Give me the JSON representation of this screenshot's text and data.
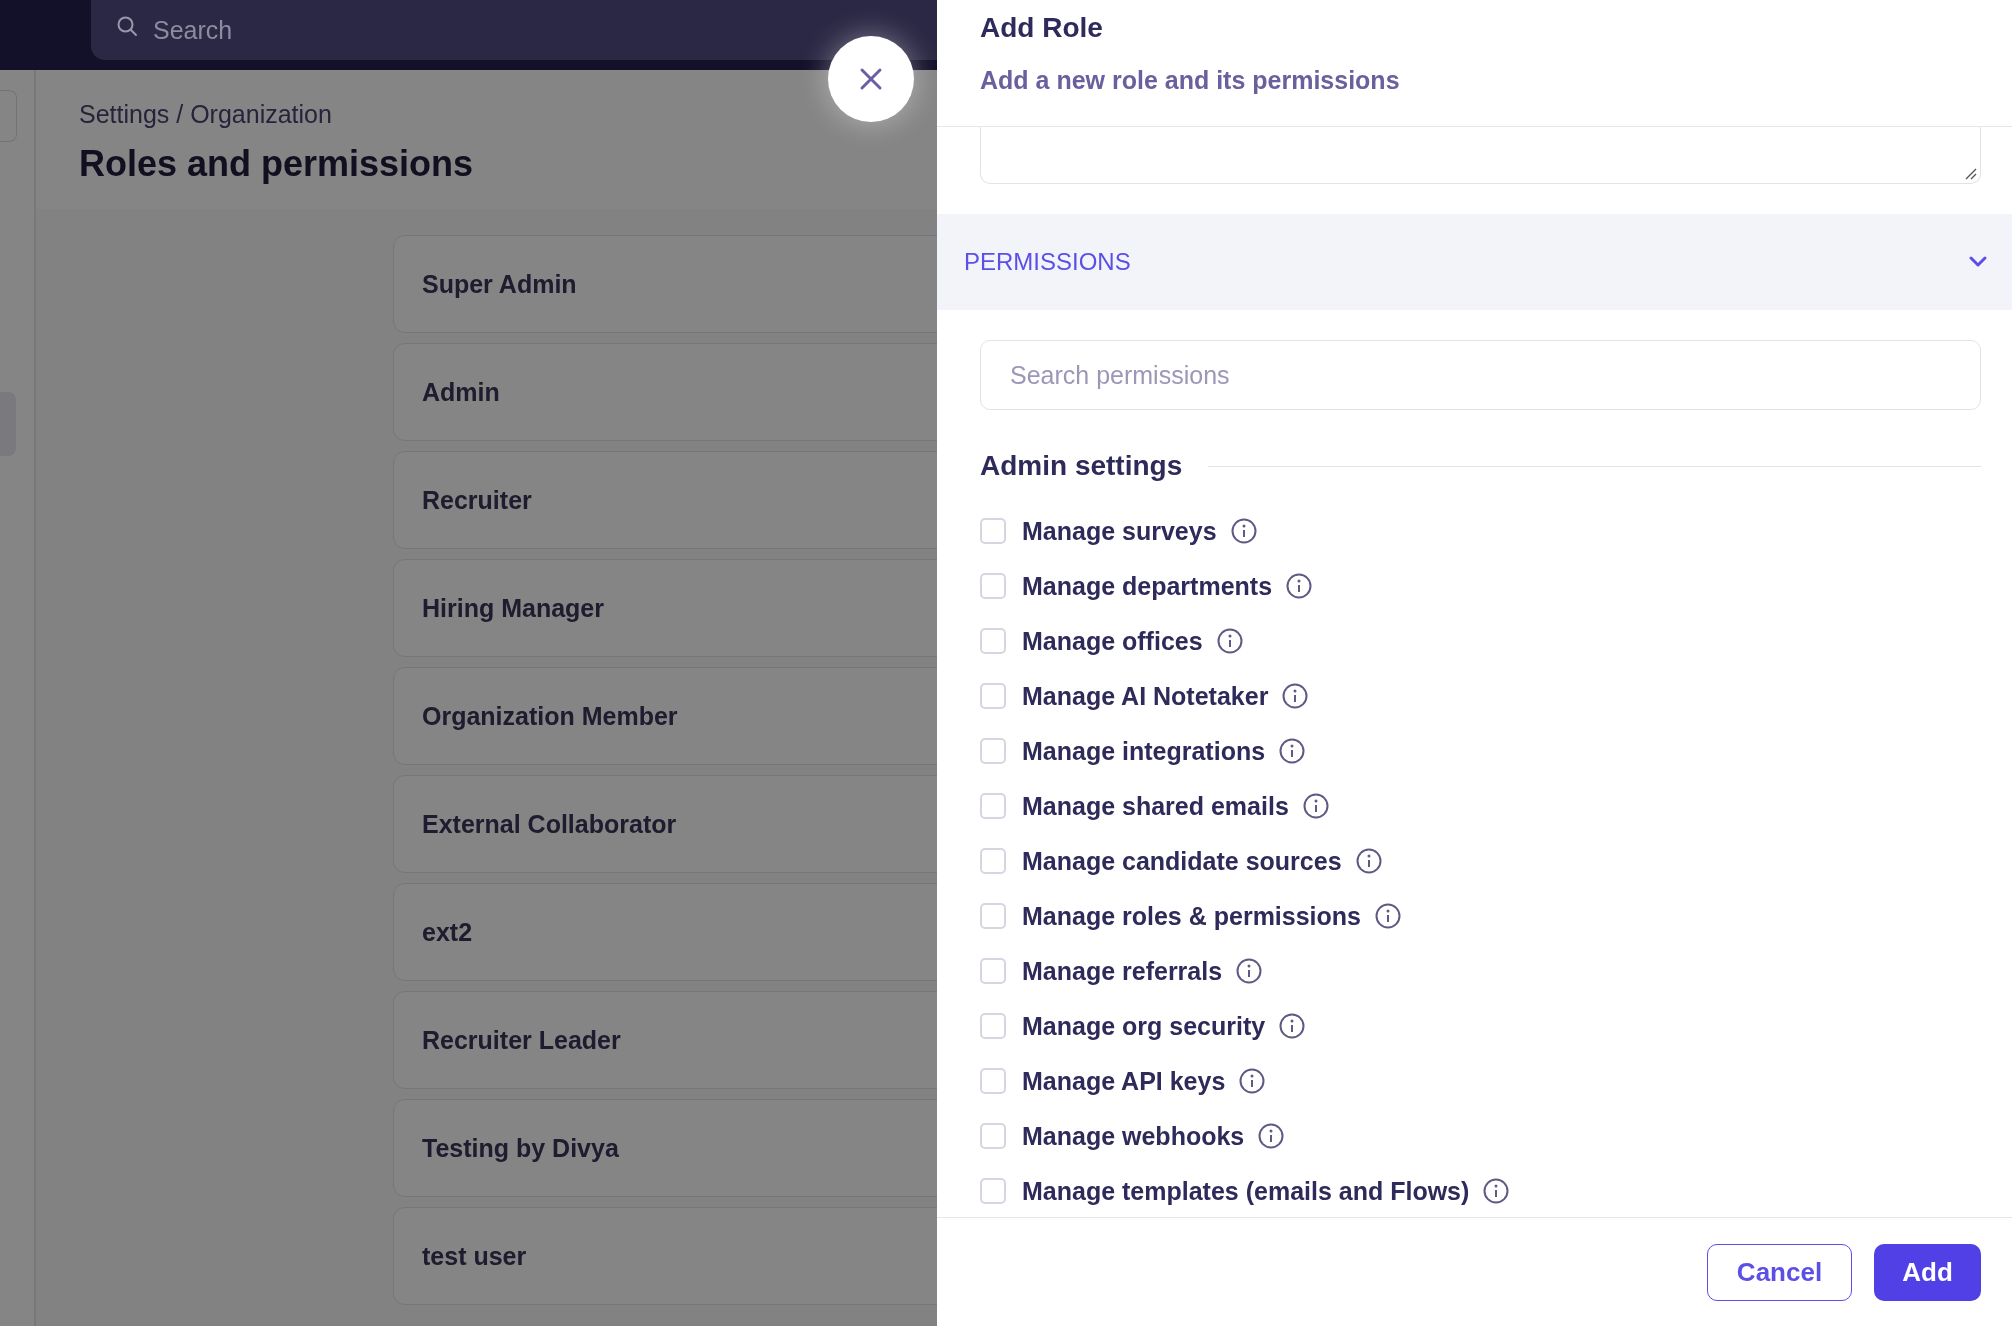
{
  "topbar": {
    "search": {
      "placeholder": "Search"
    }
  },
  "page": {
    "breadcrumb": "Settings / Organization",
    "title": "Roles and permissions",
    "roles": [
      {
        "name": "Super Admin"
      },
      {
        "name": "Admin"
      },
      {
        "name": "Recruiter"
      },
      {
        "name": "Hiring Manager"
      },
      {
        "name": "Organization Member"
      },
      {
        "name": "External Collaborator"
      },
      {
        "name": "ext2"
      },
      {
        "name": "Recruiter Leader"
      },
      {
        "name": "Testing by Divya"
      },
      {
        "name": "test user"
      }
    ]
  },
  "drawer": {
    "title": "Add Role",
    "subtitle": "Add a new role and its permissions",
    "section": {
      "label": "PERMISSIONS",
      "expanded": true
    },
    "search": {
      "placeholder": "Search permissions"
    },
    "group": {
      "title": "Admin settings",
      "permissions": [
        {
          "label": "Manage surveys",
          "checked": false
        },
        {
          "label": "Manage departments",
          "checked": false
        },
        {
          "label": "Manage offices",
          "checked": false
        },
        {
          "label": "Manage AI Notetaker",
          "checked": false
        },
        {
          "label": "Manage integrations",
          "checked": false
        },
        {
          "label": "Manage shared emails",
          "checked": false
        },
        {
          "label": "Manage candidate sources",
          "checked": false
        },
        {
          "label": "Manage roles & permissions",
          "checked": false
        },
        {
          "label": "Manage referrals",
          "checked": false
        },
        {
          "label": "Manage org security",
          "checked": false
        },
        {
          "label": "Manage API keys",
          "checked": false
        },
        {
          "label": "Manage webhooks",
          "checked": false
        },
        {
          "label": "Manage templates (emails and Flows)",
          "checked": false
        }
      ]
    },
    "buttons": [
      {
        "label": "Cancel",
        "kind": "secondary"
      },
      {
        "label": "Add",
        "kind": "primary"
      }
    ]
  }
}
